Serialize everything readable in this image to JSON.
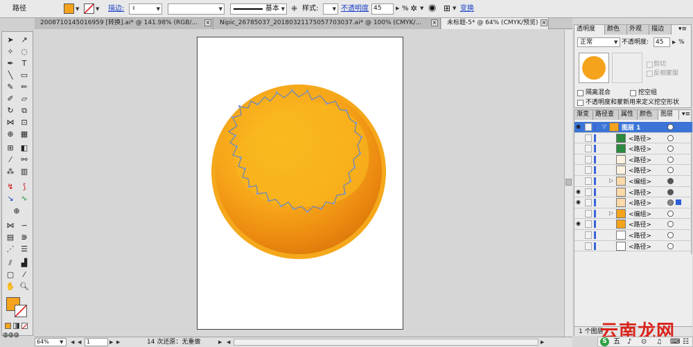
{
  "control": {
    "object_type": "路径",
    "stroke_label": "描边:",
    "stroke_profile": "基本",
    "style_label": "样式:",
    "opacity_label": "不透明度",
    "opacity_value": "45",
    "percent": "%",
    "transform_link": "变换",
    "fill_color": "#f5a31c"
  },
  "tabs": [
    {
      "label": "200871014501695​9 [转换].ai* @ 141.98% (RGB/..."
    },
    {
      "label": "Nipic_26785037_20180321175057703037.ai* @ 100% (CMYK/..."
    },
    {
      "label": "未标题-5* @ 64% (CMYK/预览)"
    }
  ],
  "status": {
    "zoom": "64%",
    "page": "1",
    "undo_text": "14 次还原：无重做"
  },
  "transparency": {
    "tabs": [
      "透明度",
      "颜色",
      "外观",
      "描边"
    ],
    "blend_mode": "正常",
    "opacity_label": "不透明度:",
    "opacity_value": "45",
    "percent": "%",
    "clip_label": "剪切",
    "invert_label": "反相蒙版",
    "isolate_label": "隔离混合",
    "knockout_label": "挖空组",
    "define_label": "不透明度和蒙新用来定义挖空形状"
  },
  "layers": {
    "tabs": [
      "渐变",
      "路径查",
      "属性",
      "颜色",
      "图层"
    ],
    "rows": [
      {
        "name": "图层 1",
        "eye": true,
        "expand": "▽",
        "selected": true,
        "thumb": "orange"
      },
      {
        "name": "<路径>",
        "eye": false,
        "thumb": "green"
      },
      {
        "name": "<路径>",
        "eye": false,
        "thumb": "green"
      },
      {
        "name": "<路径>",
        "eye": false,
        "thumb": "light"
      },
      {
        "name": "<路径>",
        "eye": false,
        "thumb": "light"
      },
      {
        "name": "<编组>",
        "eye": false,
        "expand": "▷",
        "thumb": "peach",
        "dot": "filled"
      },
      {
        "name": "<路径>",
        "eye": true,
        "thumb": "peach",
        "dot": "filled"
      },
      {
        "name": "<路径>",
        "eye": true,
        "thumb": "peach",
        "dot": "gray",
        "square": true
      },
      {
        "name": "<编组>",
        "eye": false,
        "expand": "▷",
        "thumb": "orange"
      },
      {
        "name": "<路径>",
        "eye": true,
        "thumb": "orange"
      },
      {
        "name": "<路径>",
        "eye": false,
        "thumb": "white"
      },
      {
        "name": "<路径>",
        "eye": false,
        "thumb": "white"
      }
    ],
    "footer": "1 个图层"
  },
  "watermark": "云南龙网",
  "ime": [
    "五",
    "♪",
    "⊙",
    "🎤"
  ]
}
